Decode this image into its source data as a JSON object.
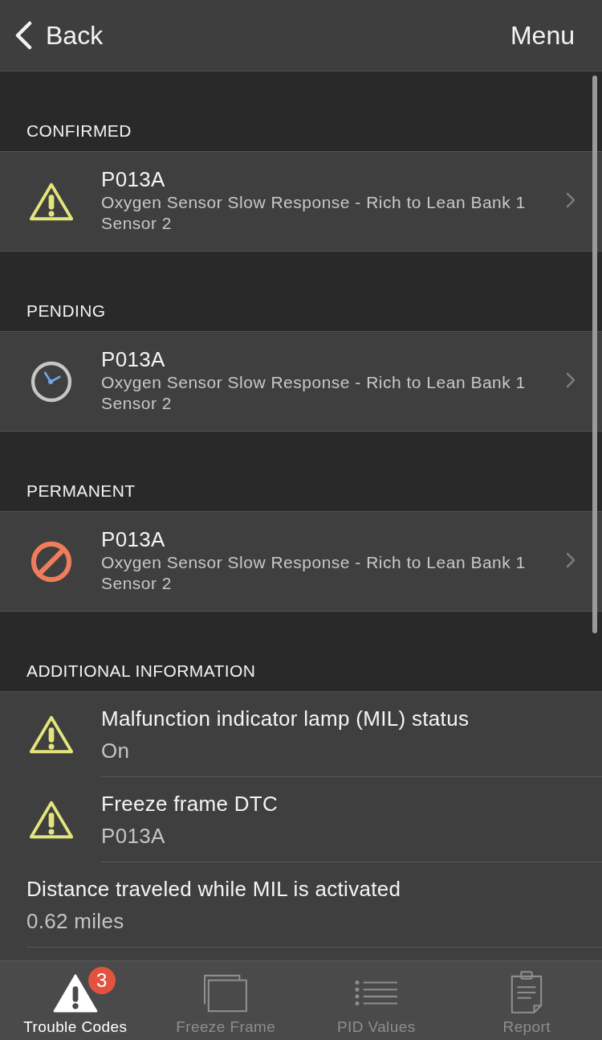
{
  "nav_bar": {
    "back": "Back",
    "menu": "Menu"
  },
  "sections": [
    {
      "header": "CONFIRMED",
      "codes": [
        {
          "kind": "confirmed",
          "code": "P013A",
          "description": "Oxygen Sensor Slow Response - Rich to Lean Bank 1 Sensor 2"
        }
      ]
    },
    {
      "header": "PENDING",
      "codes": [
        {
          "kind": "pending",
          "code": "P013A",
          "description": "Oxygen Sensor Slow Response - Rich to Lean Bank 1 Sensor 2"
        }
      ]
    },
    {
      "header": "PERMANENT",
      "codes": [
        {
          "kind": "permanent",
          "code": "P013A",
          "description": "Oxygen Sensor Slow Response - Rich to Lean Bank 1 Sensor 2"
        }
      ]
    }
  ],
  "additional_information": {
    "header": "ADDITIONAL INFORMATION",
    "items": [
      {
        "kind": "warning",
        "label": "Malfunction indicator lamp (MIL) status",
        "value": "On"
      },
      {
        "kind": "warning",
        "label": "Freeze frame DTC",
        "value": "P013A"
      },
      {
        "kind": "plain",
        "label": "Distance traveled while MIL is activated",
        "value": "0.62 miles"
      }
    ]
  },
  "tab_bar": [
    {
      "kind": "warning",
      "label": "Trouble Codes",
      "selected": true,
      "badge": "3"
    },
    {
      "kind": "frames",
      "label": "Freeze Frame",
      "selected": false
    },
    {
      "kind": "list",
      "label": "PID Values",
      "selected": false
    },
    {
      "kind": "clipboard",
      "label": "Report",
      "selected": false
    }
  ]
}
